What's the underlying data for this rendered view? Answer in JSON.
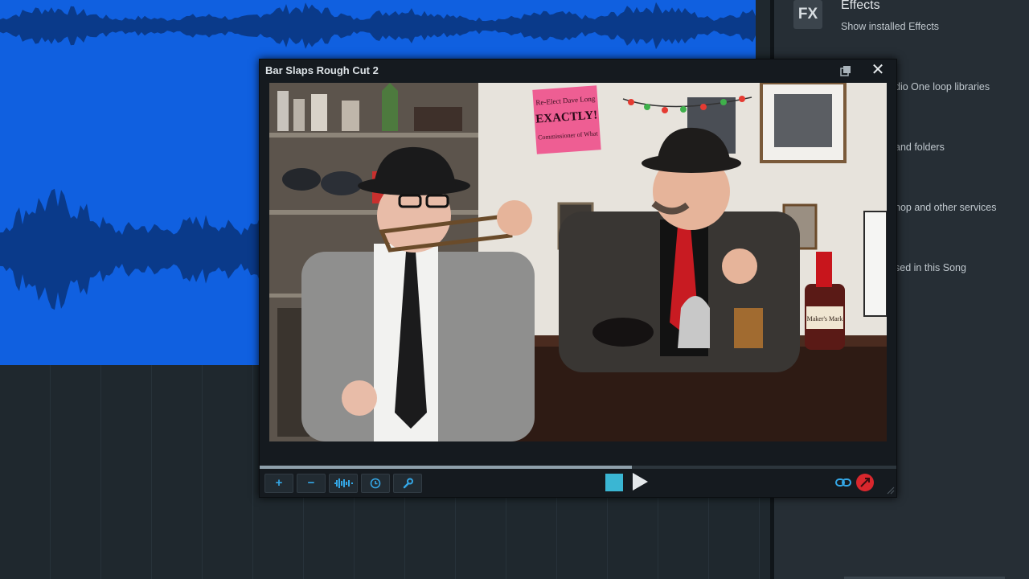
{
  "browser": {
    "fx_badge": "FX",
    "title": "Effects",
    "description": "Show installed Effects",
    "items": [
      "dio One loop libraries",
      "and folders",
      "hop and other services",
      "sed in this Song"
    ]
  },
  "video_window": {
    "title": "Bar Slaps Rough Cut 2",
    "playback_progress": 0.585,
    "toolbar": {
      "zoom_in_label": "+",
      "zoom_out_label": "−",
      "icons": [
        "waveform-icon",
        "clock-icon",
        "wrench-icon",
        "link-icon",
        "sync-icon"
      ]
    }
  },
  "scene_text": {
    "sign_line1": "Re-Elect Dave Long",
    "sign_line2": "EXACTLY!",
    "sign_line3": "Commissioner of What",
    "bottle_label": "Maker's Mark"
  },
  "colors": {
    "audio_track": "#1060e0",
    "waveform": "#0a3a8a",
    "accent_blue": "#34a7e6",
    "stop_button": "#3ab6d3",
    "sync_button": "#d9272d"
  }
}
